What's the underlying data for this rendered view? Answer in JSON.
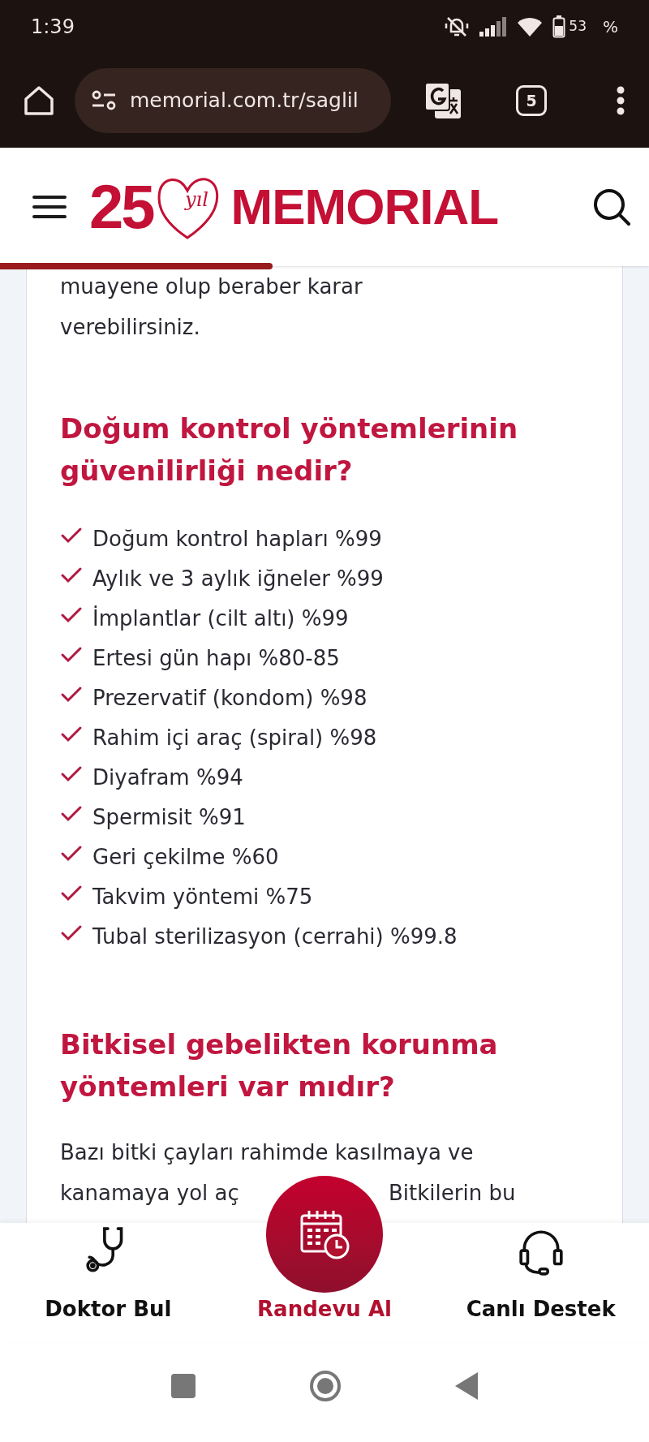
{
  "status_bar": {
    "time": "1:39",
    "battery": "53",
    "battery_unit": "%"
  },
  "browser": {
    "url": "memorial.com.tr/saglil",
    "tab_count": "5"
  },
  "site_header": {
    "logo_number": "25",
    "logo_script": "yıl",
    "logo_name": "MEMORIAL",
    "scroll_progress": {
      "level": 0.42
    }
  },
  "article": {
    "intro_lines": [
      "muayene olup beraber karar",
      "verebilirsiniz."
    ],
    "heading_1": [
      "Doğum kontrol yöntemlerinin",
      "güvenilirliği nedir?"
    ],
    "checklist": [
      "Doğum kontrol hapları %99",
      "Aylık ve 3 aylık iğneler %99",
      "İmplantlar (cilt altı) %99",
      "Ertesi gün hapı %80-85",
      "Prezervatif (kondom) %98",
      "Rahim içi araç (spiral) %98",
      "Diyafram %94",
      "Spermisit %91",
      "Geri çekilme %60",
      "Takvim yöntemi %75",
      "Tubal sterilizasyon (cerrahi) %99.8"
    ],
    "heading_2": [
      "Bitkisel gebelikten korunma",
      "yöntemleri var mıdır?"
    ],
    "paragraph_line_1": "Bazı bitki çayları rahimde kasılmaya ve",
    "paragraph_line_2_left": "kanamaya yol aç",
    "paragraph_line_2_right": "Bitkilerin bu"
  },
  "bottom_nav": [
    {
      "kind": "stethoscope",
      "label": "Doktor Bul",
      "selected": false
    },
    {
      "kind": "calendar",
      "label": "Randevu Al",
      "selected": true
    },
    {
      "kind": "headset",
      "label": "Canlı Destek",
      "selected": false
    }
  ]
}
